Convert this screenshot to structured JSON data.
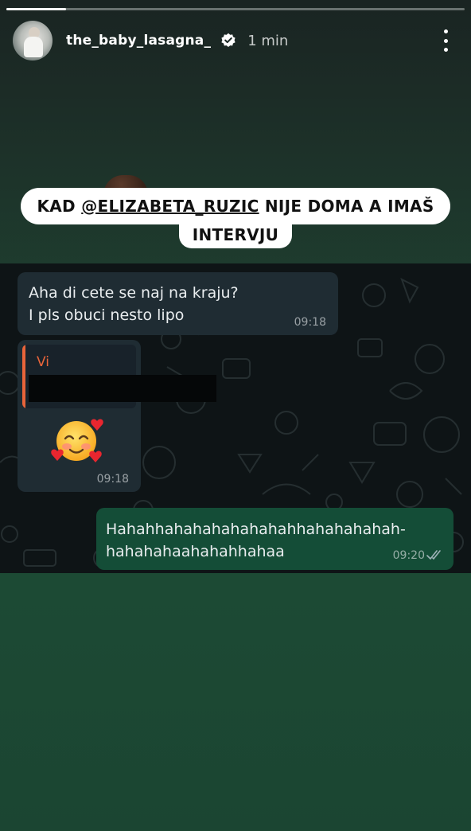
{
  "story": {
    "progress": 0.13,
    "username": "the_baby_lasagna_",
    "verified": true,
    "time_ago": "1 min",
    "icons": {
      "verified": "verified-badge-icon",
      "more": "more-vertical-icon"
    }
  },
  "caption": {
    "prefix": "KAD ",
    "mention": "@ELIZABETA_RUZIC",
    "suffix": " NIJE DOMA A IMAŠ",
    "line2": "INTERVJU"
  },
  "chat": {
    "messages": [
      {
        "direction": "incoming",
        "lines": [
          "Aha di cete se naj na kraju?",
          "I pls obuci nesto lipo"
        ],
        "time": "09:18"
      },
      {
        "direction": "incoming",
        "reply_to": "Vi",
        "emoji": "smiling-face-with-hearts",
        "time": "09:18"
      },
      {
        "direction": "outgoing",
        "lines": [
          "Hahahhahahahahahahahhahahahahah-",
          "hahahahaahahahhahaa"
        ],
        "time": "09:20",
        "status": "read-double-tick"
      }
    ]
  },
  "colors": {
    "incoming_bubble": "#1f2c33",
    "outgoing_bubble": "#144d37",
    "quote_accent": "#e8643a",
    "chat_bg": "#0e1416"
  }
}
